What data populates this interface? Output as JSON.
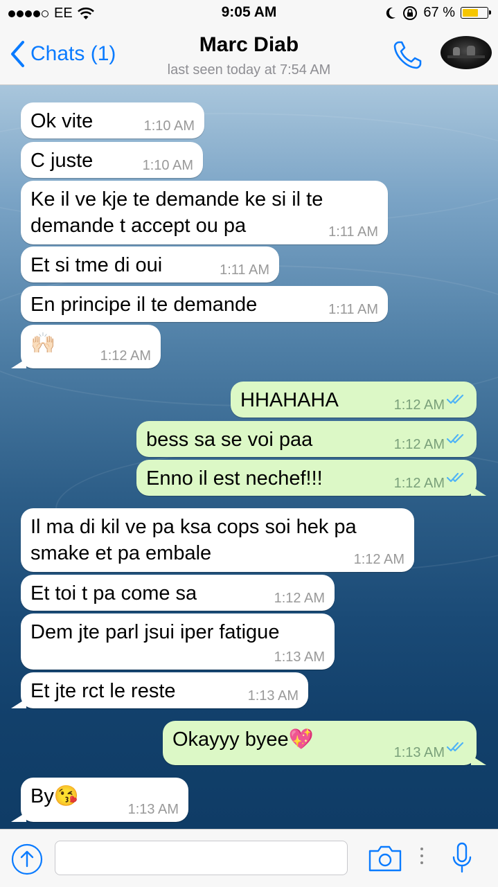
{
  "status_bar": {
    "carrier": "EE",
    "time": "9:05 AM",
    "battery_text": "67 %",
    "battery_level": 0.67,
    "signal_bars_filled": 4,
    "signal_bars_total": 5
  },
  "header": {
    "back_label": "Chats (1)",
    "contact_name": "Marc Diab",
    "last_seen": "last seen today at 7:54 AM",
    "call_icon": "phone-icon",
    "avatar_icon": "contact-avatar"
  },
  "colors": {
    "accent": "#0a7bff",
    "outgoing_bubble": "#dcf8c6",
    "incoming_bubble": "#ffffff",
    "read_ticks": "#4fb3f6"
  },
  "messages": [
    {
      "dir": "in",
      "lines": [
        "Ok vite"
      ],
      "time": "1:10 AM"
    },
    {
      "dir": "in",
      "lines": [
        "C juste"
      ],
      "time": "1:10 AM"
    },
    {
      "dir": "in",
      "lines": [
        "Ke il ve kje te demande ke  si il te",
        "demande t accept ou pa"
      ],
      "time": "1:11 AM"
    },
    {
      "dir": "in",
      "lines": [
        "Et si tme di oui"
      ],
      "time": "1:11 AM"
    },
    {
      "dir": "in",
      "lines": [
        "En principe il te demande"
      ],
      "time": "1:11 AM"
    },
    {
      "dir": "in",
      "lines": [
        "🙌🏻"
      ],
      "time": "1:12 AM"
    },
    {
      "dir": "out",
      "lines": [
        "HHAHAHA"
      ],
      "time": "1:12 AM",
      "status": "read"
    },
    {
      "dir": "out",
      "lines": [
        "bess sa se voi paa"
      ],
      "time": "1:12 AM",
      "status": "read"
    },
    {
      "dir": "out",
      "lines": [
        "Enno il est nechef!!!"
      ],
      "time": "1:12 AM",
      "status": "read"
    },
    {
      "dir": "in",
      "lines": [
        "Il ma di kil ve pa ksa cops soi hek pa",
        "smake et pa embale"
      ],
      "time": "1:12 AM"
    },
    {
      "dir": "in",
      "lines": [
        "Et toi  t pa come sa"
      ],
      "time": "1:12 AM"
    },
    {
      "dir": "in",
      "lines": [
        "Dem jte parl jsui iper fatigue"
      ],
      "time": "1:13 AM"
    },
    {
      "dir": "in",
      "lines": [
        "Et jte rct le reste"
      ],
      "time": "1:13 AM"
    },
    {
      "dir": "out",
      "lines": [
        "Okayyy byee💖"
      ],
      "time": "1:13 AM",
      "status": "read"
    },
    {
      "dir": "in",
      "lines": [
        "By😘"
      ],
      "time": "1:13 AM"
    }
  ],
  "composer": {
    "placeholder": "",
    "value": "",
    "upload_icon": "upload-arrow-icon",
    "camera_icon": "camera-icon",
    "more_icon": "more-dots-icon",
    "mic_icon": "microphone-icon"
  }
}
